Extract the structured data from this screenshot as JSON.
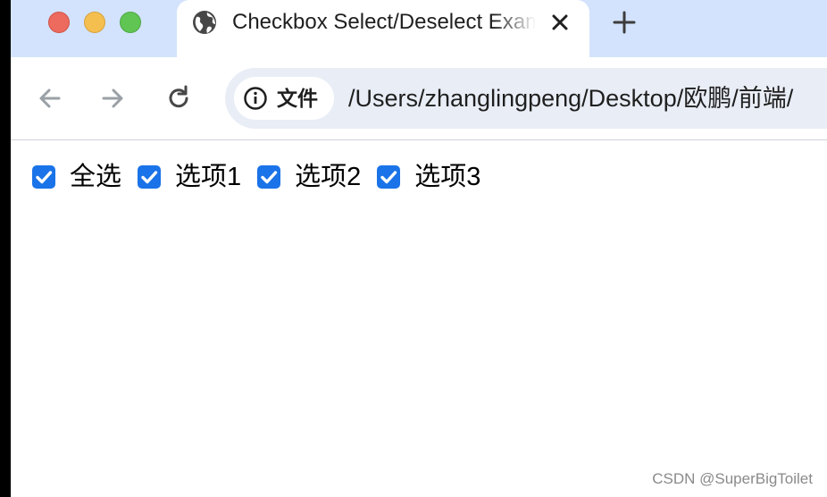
{
  "window": {
    "traffic_lights": [
      "close",
      "minimize",
      "zoom"
    ],
    "colors": {
      "close": "#ed6a5e",
      "minimize": "#f5bf4f",
      "zoom": "#61c554"
    }
  },
  "tab": {
    "title": "Checkbox Select/Deselect Example",
    "favicon": "globe-icon",
    "close_icon": "close-icon"
  },
  "new_tab_icon": "plus-icon",
  "toolbar": {
    "back_icon": "back-arrow-icon",
    "forward_icon": "forward-arrow-icon",
    "reload_icon": "reload-icon",
    "site_info_icon": "info-icon",
    "site_chip_label": "文件",
    "url": "/Users/zhanglingpeng/Desktop/欧鹏/前端/"
  },
  "checkboxes": [
    {
      "label": "全选",
      "checked": true
    },
    {
      "label": "选项1",
      "checked": true
    },
    {
      "label": "选项2",
      "checked": true
    },
    {
      "label": "选项3",
      "checked": true
    }
  ],
  "accent_color": "#1a73e8",
  "watermark": "CSDN @SuperBigToilet"
}
